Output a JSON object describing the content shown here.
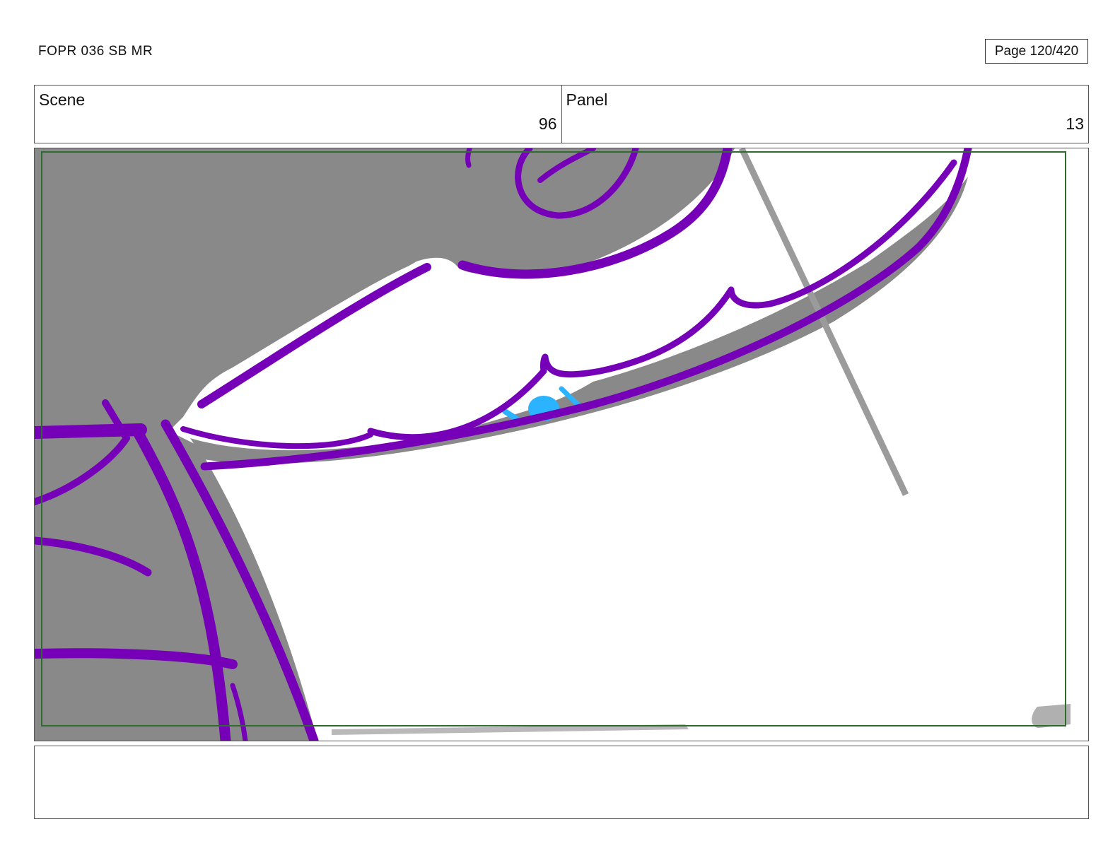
{
  "header": {
    "title": "FOPR 036 SB MR",
    "page_label": "Page 120/420"
  },
  "info": {
    "scene_label": "Scene",
    "scene_value": "96",
    "panel_label": "Panel",
    "panel_value": "13"
  },
  "artwork": {
    "description_icon": "storyboard-sketch-image",
    "colors": {
      "linework": "#7500b8",
      "shadow": "#898989",
      "eye": "#2bb3ff",
      "safe_frame": "#2e6b2e",
      "construction": "#9b9b9b"
    }
  },
  "notes": {
    "text": ""
  }
}
